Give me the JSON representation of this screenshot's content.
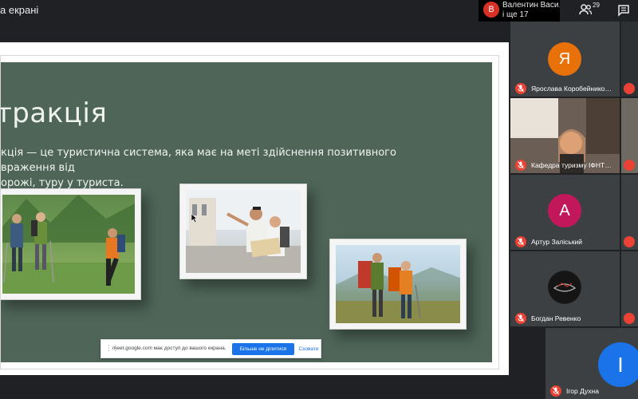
{
  "topbar": {
    "presenting_label": "а екрані",
    "host_initial": "В",
    "host_name": "Валентин Васи…",
    "host_more": "і ще 17",
    "people_count": "29",
    "people_icon": "people-icon",
    "chat_icon": "chat-icon"
  },
  "slide": {
    "title": "тракція",
    "body_line1": "кція — це туристична система, яка має на меті здійснення позитивного враження від",
    "body_line2": "орожі, туру у туриста.",
    "photos": [
      "hikers-photo",
      "guide-map-photo",
      "backpackers-photo"
    ]
  },
  "share_notice": {
    "text": "meet.google.com має доступ до вашого екрана.",
    "stop_label": "Більше не ділитися",
    "hide_label": "Сховати"
  },
  "participants": [
    {
      "initial": "Я",
      "name": "Ярослава Коробейнико…",
      "color": "#e8710a"
    },
    {
      "initial": "",
      "name": "Кафедра туризму ІФНТ…",
      "color": ""
    },
    {
      "initial": "А",
      "name": "Артур Заліський",
      "color": "#c2185b"
    },
    {
      "initial": "",
      "name": "Богдан Ревенко",
      "color": ""
    },
    {
      "initial": "І",
      "name": "Ігор Духна",
      "color": "#1a73e8"
    }
  ],
  "colors": {
    "slide_bg": "#4e6558",
    "meet_bg": "#202124",
    "tile_bg": "#3c4043",
    "mic_off": "#ea4335",
    "accent": "#1a73e8"
  }
}
